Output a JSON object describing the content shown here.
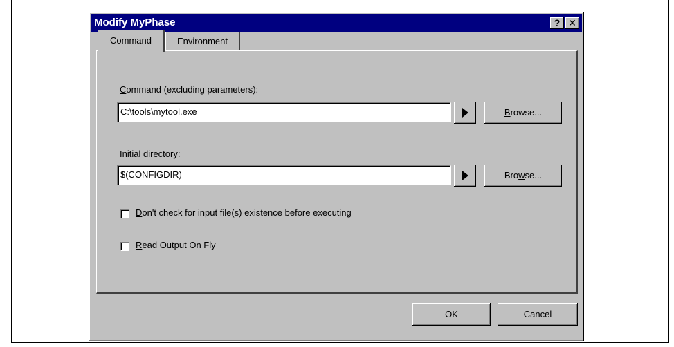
{
  "dialog": {
    "title": "Modify MyPhase",
    "help_label": "?",
    "close_label": "✕"
  },
  "tabs": [
    {
      "label": "Command",
      "active": true
    },
    {
      "label": "Environment",
      "active": false
    }
  ],
  "command": {
    "label_mnemonic": "C",
    "label_rest": "ommand (excluding parameters):",
    "value": "C:\\tools\\mytool.exe",
    "browse_mnemonic": "B",
    "browse_rest": "rowse..."
  },
  "initial_dir": {
    "label_mnemonic": "I",
    "label_rest": "nitial directory:",
    "value": "$(CONFIGDIR)",
    "browse_pre": "Bro",
    "browse_mnemonic": "w",
    "browse_post": "se..."
  },
  "options": {
    "dont_check_mnemonic": "D",
    "dont_check_rest": "on't check for input file(s) existence before executing",
    "dont_check_checked": false,
    "read_output_mnemonic": "R",
    "read_output_rest": "ead Output On Fly",
    "read_output_checked": false
  },
  "footer": {
    "ok_label": "OK",
    "cancel_label": "Cancel"
  }
}
